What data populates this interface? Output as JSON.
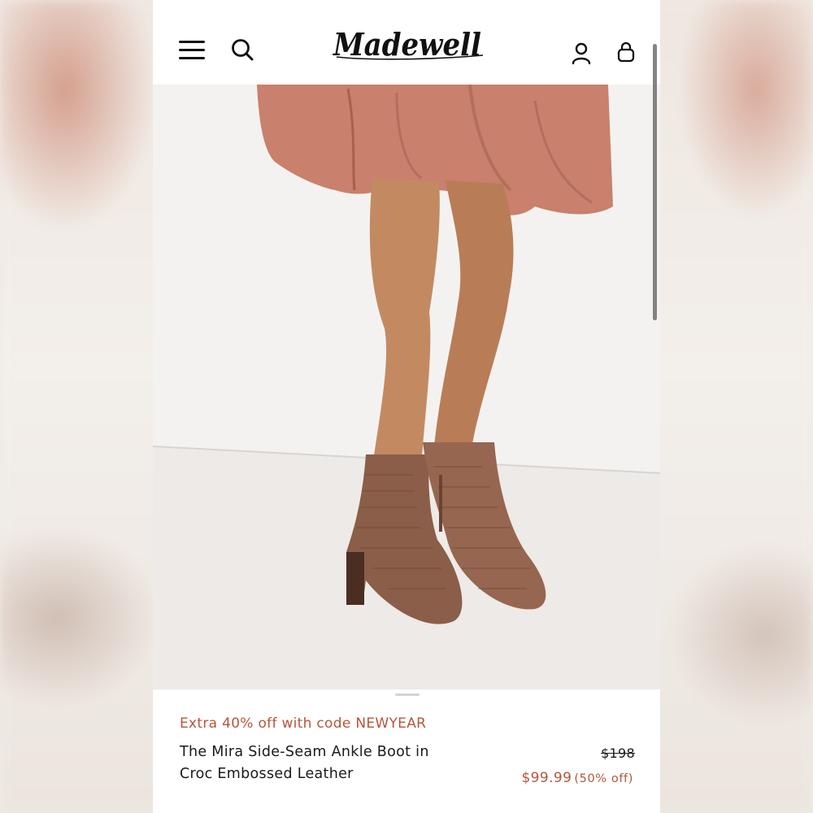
{
  "brand": {
    "logo_text": "Madewell"
  },
  "header": {
    "icons": [
      "menu-icon",
      "search-icon",
      "account-icon",
      "bag-icon"
    ]
  },
  "product": {
    "promo": "Extra 40% off with code NEWYEAR",
    "title_line1": "The Mira Side-Seam Ankle Boot in",
    "title_line2": "Croc Embossed Leather",
    "original_price": "$198",
    "sale_price": "$99.99",
    "discount": "(50% off)"
  },
  "colors": {
    "accent": "#b5553a",
    "text": "#1a1a1a",
    "background": "#ffffff"
  }
}
